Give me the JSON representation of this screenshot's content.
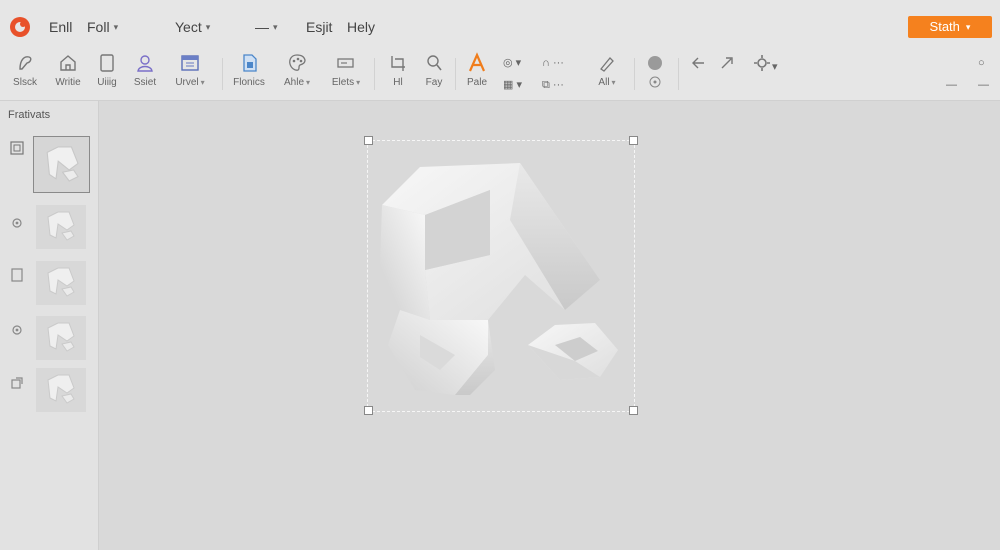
{
  "menu": {
    "items": [
      {
        "label": "Enll",
        "caret": false
      },
      {
        "label": "Foll",
        "caret": true
      },
      {
        "label": "Yect",
        "caret": true
      },
      {
        "label": "—",
        "caret": true
      },
      {
        "label": "Esjit",
        "caret": false
      },
      {
        "label": "Hely",
        "caret": false
      }
    ],
    "start_button": "Stath",
    "accent_color": "#f5811e",
    "logo_color": "#e8512a"
  },
  "toolbar": {
    "tools": [
      {
        "label": "Slsck",
        "icon": "pen-tool-icon"
      },
      {
        "label": "Writie",
        "icon": "home-icon"
      },
      {
        "label": "Uiiig",
        "icon": "page-icon"
      },
      {
        "label": "Ssiet",
        "icon": "user-icon"
      },
      {
        "label": "Urvel",
        "icon": "panel-icon"
      },
      {
        "label": "Flonics",
        "icon": "document-icon"
      },
      {
        "label": "Ahle",
        "icon": "palette-icon"
      },
      {
        "label": "Elets",
        "icon": "layout-icon"
      },
      {
        "label": "Hl",
        "icon": "crop-icon"
      },
      {
        "label": "Fay",
        "icon": "search-icon"
      },
      {
        "label": "Pale",
        "icon": "text-tool-icon"
      },
      {
        "label": "All",
        "icon": "brush-icon"
      }
    ],
    "mini_left": "◎ ▾",
    "mini_left2": "▦ ▾",
    "mini_arc": "∩ ···",
    "mini_link": "⧉ ···",
    "right_icons": [
      "record-icon",
      "undo-icon",
      "redo-icon",
      "settings-icon"
    ]
  },
  "panel": {
    "title": "Frativats",
    "pages": [
      {
        "icon": "frame-icon",
        "selected": true
      },
      {
        "icon": "gear-icon",
        "selected": false
      },
      {
        "icon": "page-icon",
        "selected": false
      },
      {
        "icon": "gear-icon",
        "selected": false
      },
      {
        "icon": "link-icon",
        "selected": false
      }
    ]
  }
}
